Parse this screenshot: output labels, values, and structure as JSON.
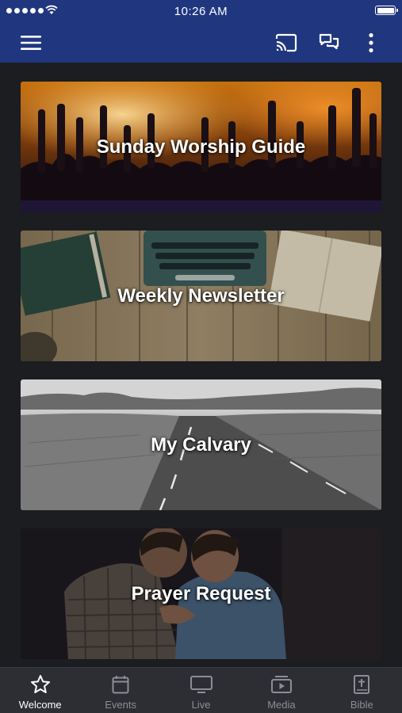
{
  "status_bar": {
    "time": "10:26 AM"
  },
  "nav": {
    "menu_icon": "hamburger-menu-icon",
    "cast_icon": "cast-icon",
    "chat_icon": "chat-bubbles-icon",
    "more_icon": "more-vertical-icon"
  },
  "cards": [
    {
      "label": "Sunday Worship Guide"
    },
    {
      "label": "Weekly Newsletter"
    },
    {
      "label": "My Calvary"
    },
    {
      "label": "Prayer Request"
    }
  ],
  "tabs": [
    {
      "label": "Welcome",
      "icon": "star-icon",
      "active": true
    },
    {
      "label": "Events",
      "icon": "calendar-icon",
      "active": false
    },
    {
      "label": "Live",
      "icon": "monitor-icon",
      "active": false
    },
    {
      "label": "Media",
      "icon": "media-player-icon",
      "active": false
    },
    {
      "label": "Bible",
      "icon": "bible-icon",
      "active": false
    }
  ],
  "colors": {
    "header": "#20367f",
    "background": "#1b1d20",
    "tabbar": "#2c2e33",
    "tab_active": "#ffffff",
    "tab_inactive": "#8b8e94"
  }
}
